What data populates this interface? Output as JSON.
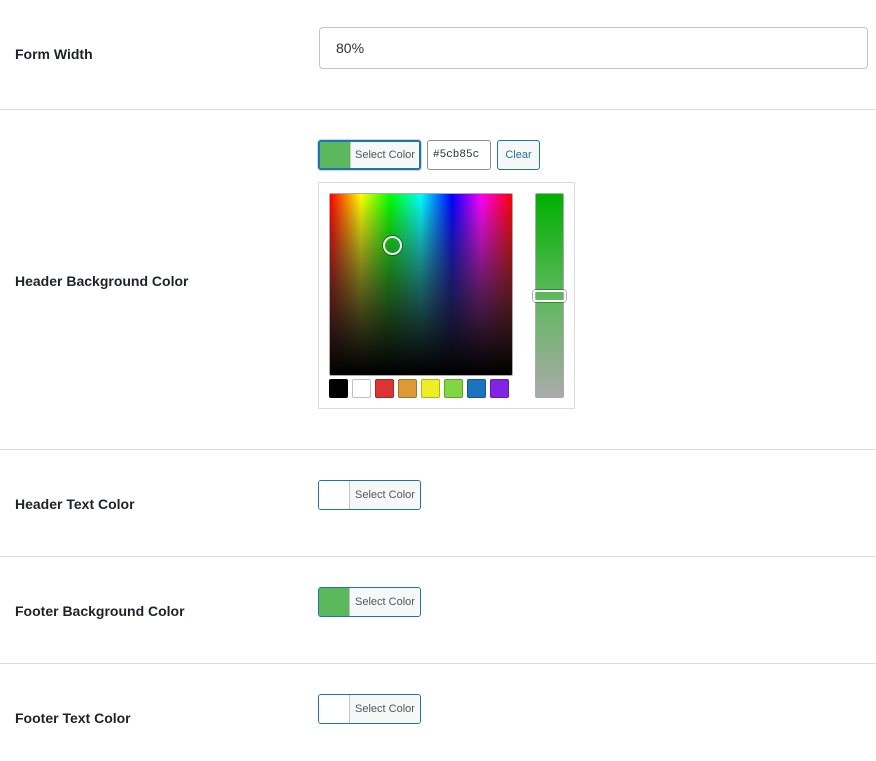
{
  "form_width": {
    "label": "Form Width",
    "value": "80%"
  },
  "header_bg": {
    "label": "Header Background Color",
    "button_label": "Select Color",
    "swatch_color": "#5cb85c",
    "hex_value": "#5cb85c",
    "clear_label": "Clear",
    "palette": [
      "#000000",
      "#ffffff",
      "#dd3333",
      "#dd9933",
      "#eeee22",
      "#81d742",
      "#1e73be",
      "#8224e3"
    ]
  },
  "header_text": {
    "label": "Header Text Color",
    "button_label": "Select Color",
    "swatch_color": "#ffffff"
  },
  "footer_bg": {
    "label": "Footer Background Color",
    "button_label": "Select Color",
    "swatch_color": "#5cb85c"
  },
  "footer_text": {
    "label": "Footer Text Color",
    "button_label": "Select Color",
    "swatch_color": "#ffffff"
  }
}
